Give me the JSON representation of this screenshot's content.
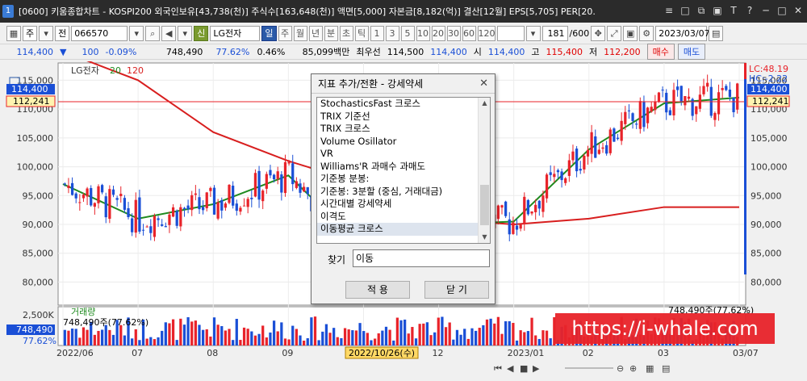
{
  "titlebar": {
    "app_icon": "1",
    "title": "[0600] 키움종합차트 - KOSPI200 외국인보유[43,738(천)] 주식수[163,648(천)] 액면[5,000] 자본금[8,182(억)] 결산[12월] EPS[5,705] PER[20.",
    "win_buttons": [
      "≡",
      "□",
      "⧉",
      "▣",
      "T",
      "?",
      "─",
      "□",
      "✕"
    ]
  },
  "toolbar": {
    "type_sel": "주",
    "stock_type": "전",
    "code": "066570",
    "tag": "신",
    "name": "LG전자",
    "periods": [
      "일",
      "주",
      "월",
      "년",
      "분",
      "초",
      "틱"
    ],
    "minutes": [
      "1",
      "3",
      "5",
      "10",
      "20",
      "30",
      "60",
      "120"
    ],
    "count": "181",
    "count_total": "/600",
    "date": "2023/03/07"
  },
  "infobar": {
    "price": "114,400",
    "change_arrow": "▼",
    "change": "100",
    "change_pct": "-0.09%",
    "volume": "748,490",
    "vol_ratio": "77.62%",
    "turnover": "0.46%",
    "amount": "85,099백만",
    "pref_label": "최우선",
    "pref_sell": "114,500",
    "pref_buy": "114,400",
    "open_label": "시",
    "open": "114,400",
    "high_label": "고",
    "high": "115,400",
    "low_label": "저",
    "low": "112,200",
    "buy_btn": "매수",
    "sell_btn": "매도"
  },
  "chart": {
    "legend_name": "LG전자",
    "ma_short": "20",
    "ma_long": "120",
    "lc_label": "LC:48.19",
    "hc_label": "HC:-2.22",
    "current_price_tag": "114,400",
    "ref_price_tag": "112,241",
    "left_price_tag": "114,400",
    "left_ref_tag": "112,241",
    "price_ticks": [
      "115,000",
      "110,000",
      "105,000",
      "100,000",
      "95,000",
      "90,000",
      "85,000",
      "80,000"
    ],
    "volume_title": "거래량",
    "volume_info": "748,490주(77.62%)",
    "volume_info_right": "748,490주(77.62%)",
    "volume_tick": "2,500K",
    "volume_tag": "748,490",
    "volume_pct_tag": "77.62%",
    "date_ticks": [
      "2022/06",
      "07",
      "08",
      "09",
      "10",
      "12",
      "2023/01",
      "02",
      "03",
      "03/07"
    ],
    "cursor_date": "2022/10/26(수)",
    "colors": {
      "up": "#e8232a",
      "down": "#1a4fd6",
      "ma20": "#1f8a1f",
      "ma120": "#d81e1e"
    }
  },
  "chart_data": {
    "type": "candlestick",
    "x": [
      "2022/06",
      "07",
      "08",
      "09",
      "10",
      "12",
      "2023/01",
      "02",
      "03",
      "03/07"
    ],
    "series": [
      {
        "name": "20",
        "values": [
          97000,
          91000,
          93500,
          98500,
          86000,
          90000,
          90500,
          103000,
          111000,
          112000
        ]
      },
      {
        "name": "120",
        "values": [
          120000,
          115000,
          106000,
          101000,
          97000,
          91000,
          90000,
          91000,
          93000,
          93000
        ]
      }
    ],
    "ylim": [
      76000,
      118000
    ]
  },
  "dialog": {
    "title": "지표 추가/전환 - 강세약세",
    "items": [
      "StochasticsFast 크로스",
      "TRIX 기준선",
      "TRIX 크로스",
      "Volume Osillator",
      "VR",
      "Williams'R 과매수 과매도",
      "기준봉 분봉:",
      "기준봉: 3분할 (중심, 거래대금)",
      "시간대별 강세약세",
      "이격도",
      "이동평균 크로스"
    ],
    "find_label": "찾기",
    "find_value": "이동",
    "apply": "적 용",
    "close": "닫 기"
  },
  "watermark": "https://i-whale.com"
}
